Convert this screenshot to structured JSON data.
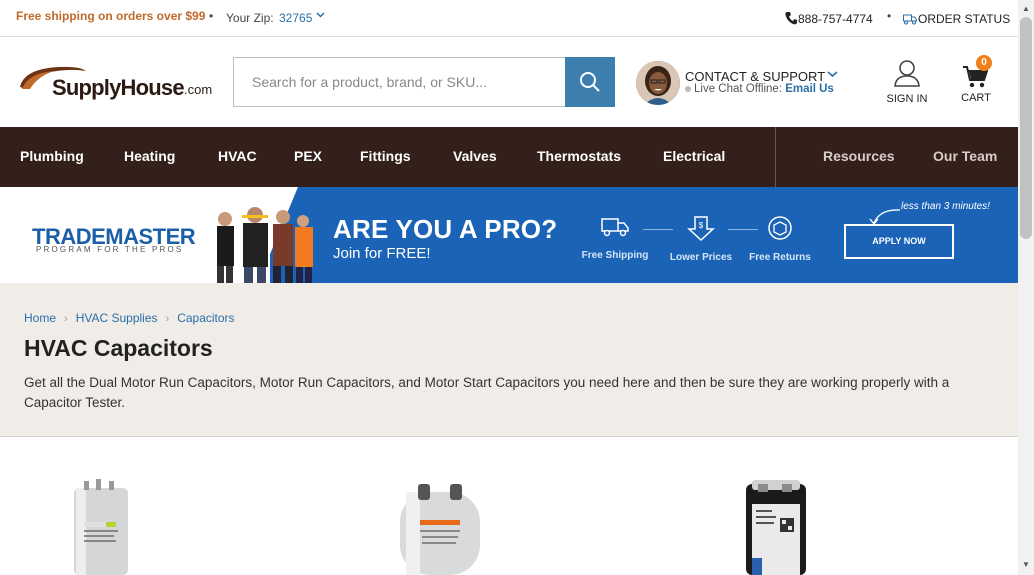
{
  "topbar": {
    "shipping_promo": "Free shipping on orders over $99",
    "zip_label": "Your Zip:",
    "zip_value": "32765",
    "phone": "888-757-4774",
    "order_status": "ORDER STATUS"
  },
  "header": {
    "logo_text": "SupplyHouse",
    "logo_suffix": ".com",
    "search_placeholder": "Search for a product, brand, or SKU...",
    "contact_title": "CONTACT & SUPPORT",
    "live_chat_status": "Live Chat Offline:",
    "email_link": "Email Us",
    "signin_label": "SIGN IN",
    "cart_label": "CART",
    "cart_count": "0"
  },
  "nav": {
    "items": [
      "Plumbing",
      "Heating",
      "HVAC",
      "PEX",
      "Fittings",
      "Valves",
      "Thermostats",
      "Electrical"
    ],
    "secondary": [
      "Resources",
      "Our Team"
    ]
  },
  "banner": {
    "program_name": "TRADEMASTER",
    "program_tagline": "PROGRAM FOR THE PROS",
    "headline": "ARE YOU A PRO?",
    "subheadline": "Join for FREE!",
    "features": [
      "Free Shipping",
      "Lower Prices",
      "Free Returns"
    ],
    "cta": "APPLY NOW",
    "time_note": "less than 3 minutes!"
  },
  "category": {
    "breadcrumbs": [
      "Home",
      "HVAC Supplies",
      "Capacitors"
    ],
    "title": "HVAC Capacitors",
    "description": "Get all the Dual Motor Run Capacitors, Motor Run Capacitors, and Motor Start Capacitors you need here and then be sure they are working properly with a Capacitor Tester."
  },
  "colors": {
    "brand_dark": "#33201a",
    "link_blue": "#2a6fa8",
    "promo_orange": "#c06a2b",
    "banner_blue": "#1b63b6",
    "badge_orange": "#f07f1a"
  }
}
